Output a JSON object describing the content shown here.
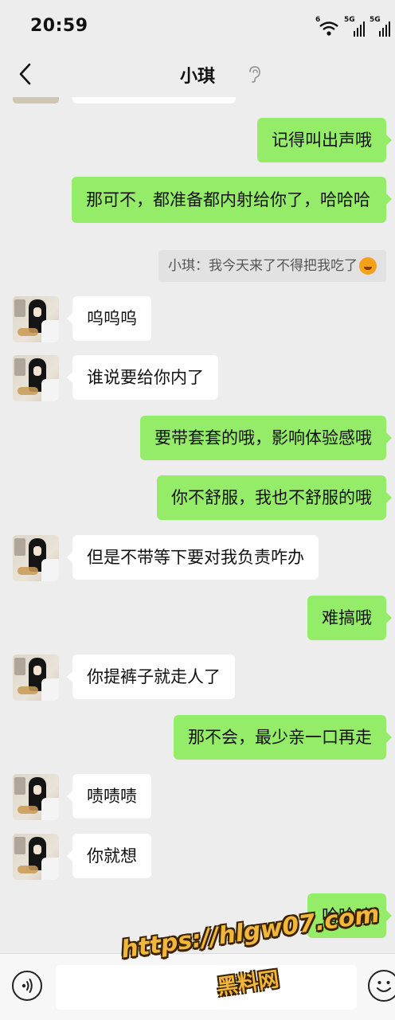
{
  "status_bar": {
    "time": "20:59",
    "signal_1_label": "5G",
    "signal_2_label": "5G",
    "wifi_badge": "6"
  },
  "nav": {
    "title": "小琪",
    "back_icon": "chevron-left-icon",
    "mute_icon": "ear-icon"
  },
  "messages": [
    {
      "from": "me",
      "text": "记得叫出声哦"
    },
    {
      "from": "me",
      "text": "那可不，都准备都内射给你了，哈哈哈"
    },
    {
      "from": "quote",
      "text": "小琪：我今天来了不得把我吃了"
    },
    {
      "from": "them",
      "text": "呜呜呜"
    },
    {
      "from": "them",
      "text": "谁说要给你内了"
    },
    {
      "from": "me",
      "text": "要带套套的哦，影响体验感哦"
    },
    {
      "from": "me",
      "text": "你不舒服，我也不舒服的哦"
    },
    {
      "from": "them",
      "text": "但是不带等下要对我负责咋办"
    },
    {
      "from": "me",
      "text": "难搞哦"
    },
    {
      "from": "them",
      "text": "你提裤子就走人了"
    },
    {
      "from": "me",
      "text": "那不会，最少亲一口再走"
    },
    {
      "from": "them",
      "text": "啧啧啧"
    },
    {
      "from": "them",
      "text": "你就想"
    },
    {
      "from": "me",
      "text": "哈哈哈"
    }
  ],
  "input_bar": {
    "voice_icon": "voice-icon",
    "placeholder": "",
    "emoji_icon": "emoji-icon"
  },
  "watermark": {
    "url": "https://hlgw07.com",
    "name": "黑料网"
  },
  "colors": {
    "background": "#ededed",
    "outgoing_bubble": "#95ec69",
    "incoming_bubble": "#ffffff",
    "watermark": "#f0b73a"
  }
}
